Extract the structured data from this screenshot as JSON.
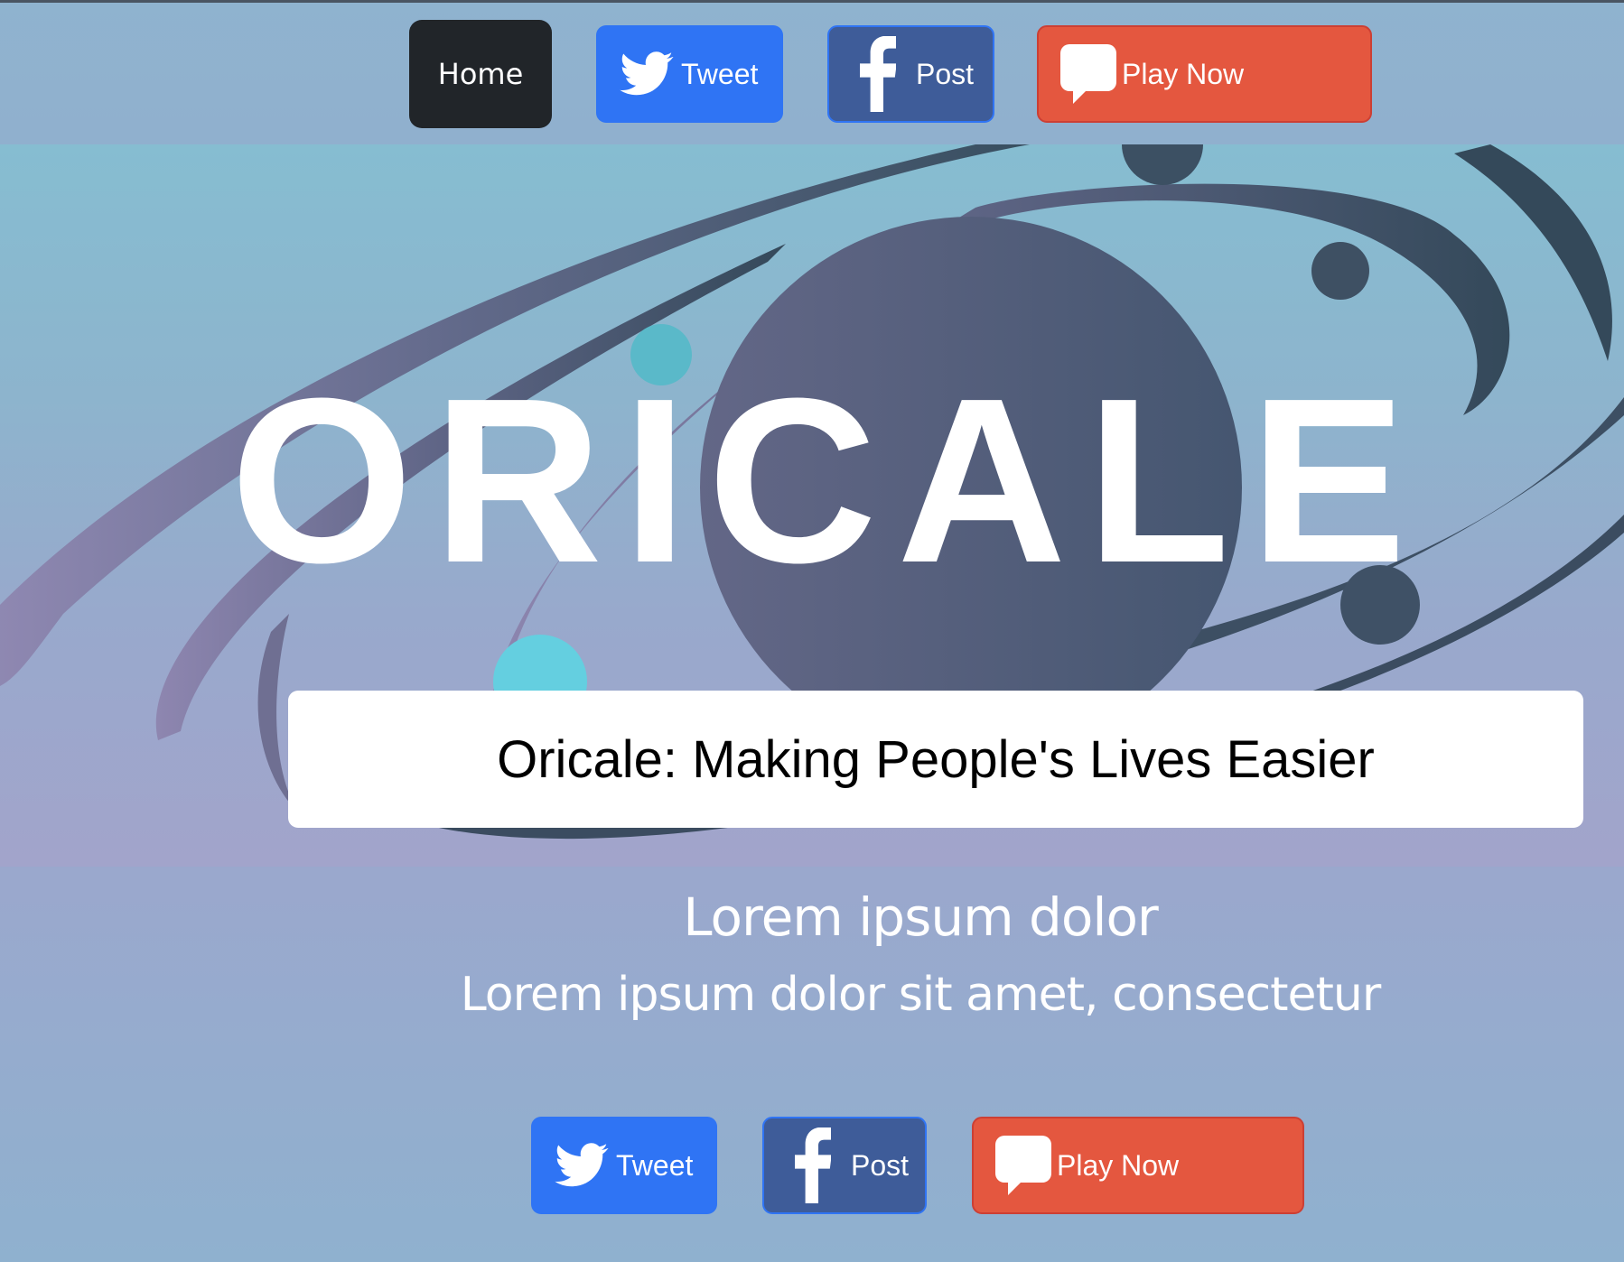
{
  "nav": {
    "home_label": "Home",
    "tweet_label": "Tweet",
    "post_label": "Post",
    "play_label": "Play Now"
  },
  "hero": {
    "logo_text": "ORICALE",
    "caption": "Oricale: Making People's Lives Easier"
  },
  "content": {
    "heading": "Lorem ipsum dolor",
    "subheading": "Lorem ipsum dolor sit amet, consectetur"
  },
  "share": {
    "tweet_label": "Tweet",
    "post_label": "Post",
    "play_label": "Play Now"
  },
  "icons": {
    "tweet": "twitter-bird-icon",
    "post": "facebook-f-icon",
    "play": "speech-bubble-icon"
  },
  "colors": {
    "tweet": "#2f74f4",
    "post": "#3e5c99",
    "play": "#e4573f",
    "home": "#212529"
  }
}
